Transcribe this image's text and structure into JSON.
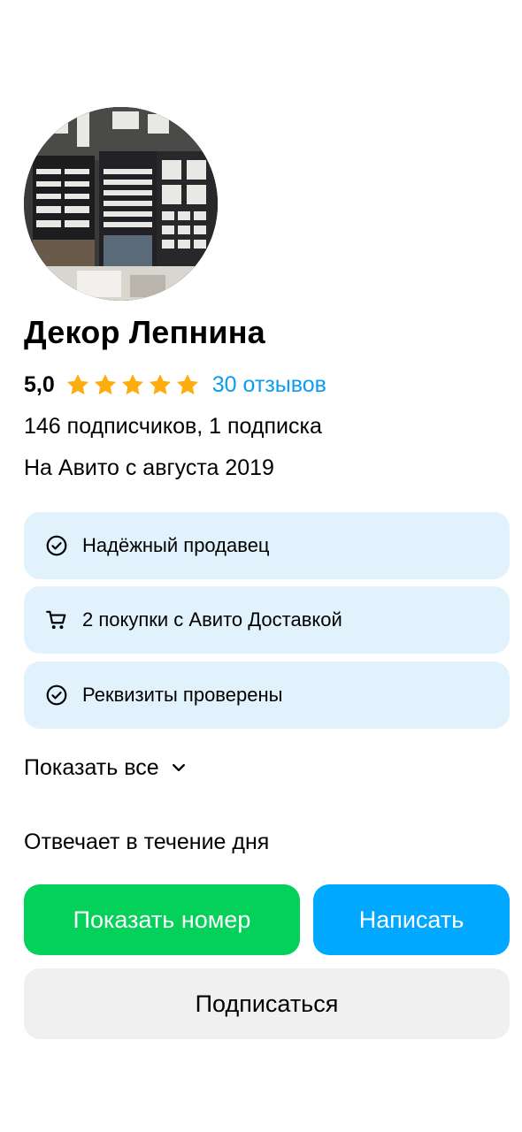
{
  "profile": {
    "avatar_icon": "store-photo-avatar",
    "name": "Декор Лепнина",
    "rating": "5,0",
    "stars": 5,
    "star_color": "#ffad0d",
    "reviews_link": "30 отзывов",
    "subscribers": "146 подписчиков, 1 подписка",
    "since": "На Авито с августа 2019"
  },
  "badges": [
    {
      "icon": "check-circle-icon",
      "label": "Надёжный продавец"
    },
    {
      "icon": "cart-icon",
      "label": "2 покупки с Авито Доставкой"
    },
    {
      "icon": "check-circle-icon",
      "label": "Реквизиты проверены"
    }
  ],
  "show_all": {
    "label": "Показать все",
    "icon": "chevron-down-icon"
  },
  "responds": "Отвечает в течение дня",
  "actions": {
    "show_phone": "Показать номер",
    "write": "Написать",
    "subscribe": "Подписаться"
  },
  "colors": {
    "badge_bg": "#e2f2fd",
    "link": "#0a9cf5",
    "phone_button": "#04d15a",
    "write_button": "#00a9ff",
    "subscribe_button": "#f0f0f0"
  }
}
